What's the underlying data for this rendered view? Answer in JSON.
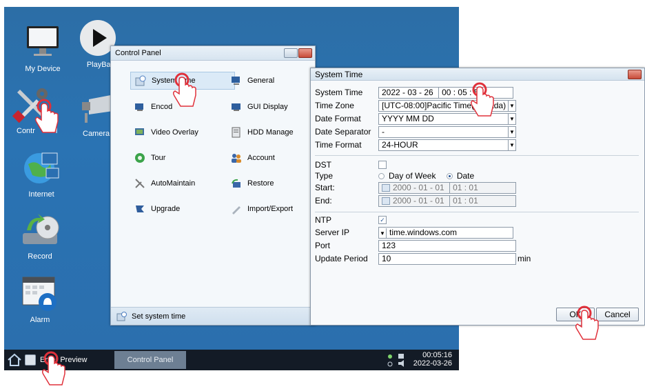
{
  "desktop": {
    "icons": [
      {
        "label": "My Device",
        "icon": "monitor-icon"
      },
      {
        "label": "PlayBac",
        "icon": "play-icon"
      },
      {
        "label": "Contr",
        "icon": "wrench-screwdriver-icon",
        "label_right": "l"
      },
      {
        "label": "Camera",
        "icon": "camera-icon"
      },
      {
        "label": "Internet",
        "icon": "globe-icon"
      },
      {
        "label": "Record",
        "icon": "record-icon"
      },
      {
        "label": "Alarm",
        "icon": "alarm-icon"
      }
    ]
  },
  "taskbar": {
    "preview_label": "Enter Preview",
    "active_task": "Control Panel",
    "clock_time": "00:05:16",
    "clock_date": "2022-03-26"
  },
  "control_panel": {
    "title": "Control Panel",
    "items": [
      {
        "label": "System Time",
        "icon": "clock-icon",
        "selected": true
      },
      {
        "label": "General",
        "icon": "monitor-small-icon"
      },
      {
        "label": "Encod",
        "icon": "encode-icon"
      },
      {
        "label": "GUI Display",
        "icon": "display-icon"
      },
      {
        "label": "Video Overlay",
        "icon": "video-overlay-icon"
      },
      {
        "label": "HDD Manage",
        "icon": "hdd-icon"
      },
      {
        "label": "Tour",
        "icon": "tour-icon"
      },
      {
        "label": "Account",
        "icon": "users-icon"
      },
      {
        "label": "AutoMaintain",
        "icon": "tools-icon"
      },
      {
        "label": "Restore",
        "icon": "restore-icon"
      },
      {
        "label": "Upgrade",
        "icon": "flag-icon"
      },
      {
        "label": "Import/Export",
        "icon": "pen-icon"
      }
    ],
    "status": "Set system time"
  },
  "system_time": {
    "title": "System Time",
    "labels": {
      "system_time": "System Time",
      "time_zone": "Time Zone",
      "date_format": "Date Format",
      "date_separator": "Date Separator",
      "time_format": "Time Format",
      "dst": "DST",
      "type": "Type",
      "start": "Start:",
      "end": "End:",
      "ntp": "NTP",
      "server_ip": "Server IP",
      "port": "Port",
      "update_period": "Update Period",
      "min": "min"
    },
    "values": {
      "system_date": "2022 - 03 - 26",
      "system_clock": "00 : 05 : 52",
      "time_zone": "[UTC-08:00]Pacific Time(Canada)",
      "date_format": "YYYY MM DD",
      "date_separator": "-",
      "time_format": "24-HOUR",
      "dst_checked": false,
      "type_option1": "Day of Week",
      "type_option2": "Date",
      "type_selected": "Date",
      "start_date": "2000 - 01 - 01",
      "start_time": "01 : 01",
      "end_date": "2000 - 01 - 01",
      "end_time": "01 : 01",
      "ntp_checked": true,
      "server_ip": "time.windows.com",
      "port": "123",
      "update_period": "10"
    },
    "buttons": {
      "ok": "OK",
      "cancel": "Cancel"
    }
  },
  "colors": {
    "desktop": "#2b6fae",
    "taskbar": "#131b26",
    "tap_marker": "#e0303a"
  }
}
